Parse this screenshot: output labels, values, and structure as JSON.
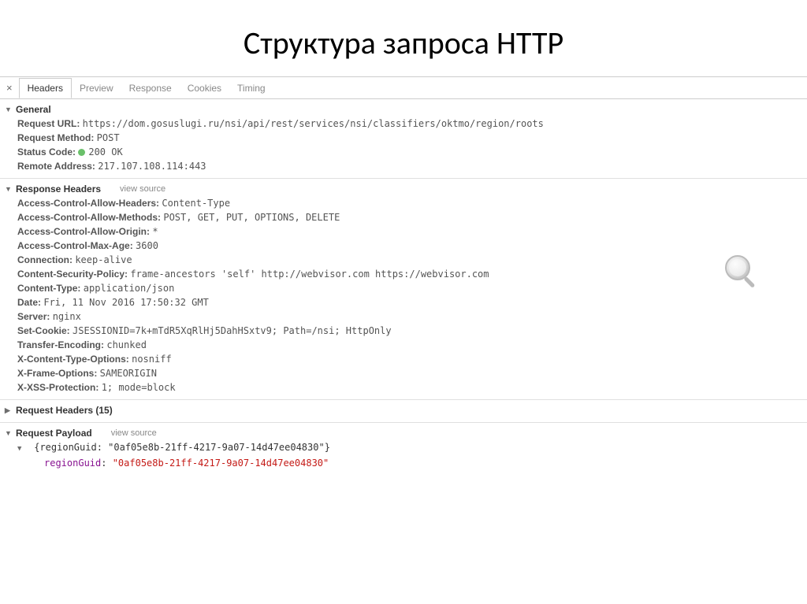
{
  "title": "Структура запроса HTTP",
  "close": "×",
  "tabs": [
    "Headers",
    "Preview",
    "Response",
    "Cookies",
    "Timing"
  ],
  "sections": {
    "general": {
      "title": "General",
      "items": [
        {
          "k": "Request URL:",
          "v": "https://dom.gosuslugi.ru/nsi/api/rest/services/nsi/classifiers/oktmo/region/roots"
        },
        {
          "k": "Request Method:",
          "v": "POST"
        },
        {
          "k": "Status Code:",
          "v": "200 OK",
          "status": true
        },
        {
          "k": "Remote Address:",
          "v": "217.107.108.114:443"
        }
      ]
    },
    "response_headers": {
      "title": "Response Headers",
      "view_source": "view source",
      "items": [
        {
          "k": "Access-Control-Allow-Headers:",
          "v": "Content-Type"
        },
        {
          "k": "Access-Control-Allow-Methods:",
          "v": "POST, GET, PUT, OPTIONS, DELETE"
        },
        {
          "k": "Access-Control-Allow-Origin:",
          "v": "*"
        },
        {
          "k": "Access-Control-Max-Age:",
          "v": "3600"
        },
        {
          "k": "Connection:",
          "v": "keep-alive"
        },
        {
          "k": "Content-Security-Policy:",
          "v": "frame-ancestors 'self' http://webvisor.com https://webvisor.com"
        },
        {
          "k": "Content-Type:",
          "v": "application/json"
        },
        {
          "k": "Date:",
          "v": "Fri, 11 Nov 2016 17:50:32 GMT"
        },
        {
          "k": "Server:",
          "v": "nginx"
        },
        {
          "k": "Set-Cookie:",
          "v": "JSESSIONID=7k+mTdR5XqRlHj5DahHSxtv9; Path=/nsi; HttpOnly"
        },
        {
          "k": "Transfer-Encoding:",
          "v": "chunked"
        },
        {
          "k": "X-Content-Type-Options:",
          "v": "nosniff"
        },
        {
          "k": "X-Frame-Options:",
          "v": "SAMEORIGIN"
        },
        {
          "k": "X-XSS-Protection:",
          "v": "1; mode=block"
        }
      ]
    },
    "request_headers": {
      "title": "Request Headers (15)"
    },
    "request_payload": {
      "title": "Request Payload",
      "view_source": "view source",
      "preview_line": "{regionGuid: \"0af05e8b-21ff-4217-9a07-14d47ee04830\"}",
      "key": "regionGuid",
      "colon": ": ",
      "value": "\"0af05e8b-21ff-4217-9a07-14d47ee04830\""
    }
  }
}
